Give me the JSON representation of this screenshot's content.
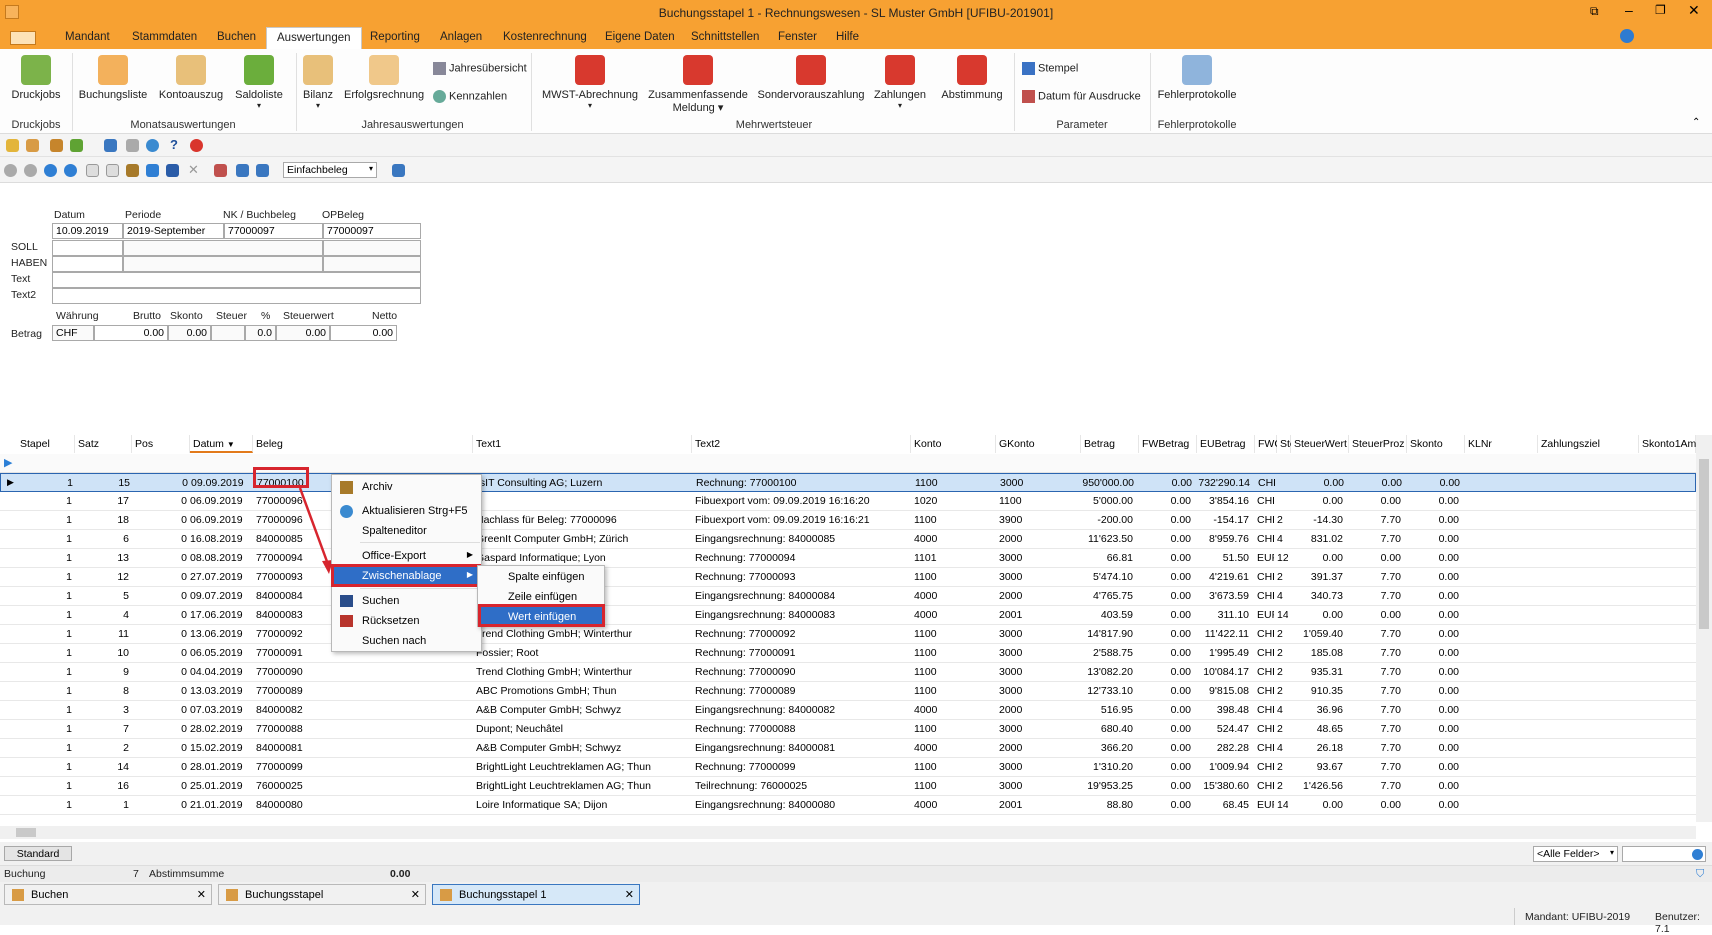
{
  "window": {
    "title": "Buchungsstapel 1 - Rechnungswesen - SL Muster GmbH [UFIBU-201901]"
  },
  "menu": [
    "Mandant",
    "Stammdaten",
    "Buchen",
    "Auswertungen",
    "Reporting",
    "Anlagen",
    "Kostenrechnung",
    "Eigene Daten",
    "Schnittstellen",
    "Fenster",
    "Hilfe"
  ],
  "ribbon": {
    "druckjobs": "Druckjobs",
    "buchungsliste": "Buchungsliste",
    "kontoauszug": "Kontoauszug",
    "saldoliste": "Saldoliste",
    "bilanz": "Bilanz",
    "erfolgsrechnung": "Erfolgsrechnung",
    "jahresuebersicht": "Jahresübersicht",
    "kennzahlen": "Kennzahlen",
    "mwst": "MWST-Abrechnung",
    "zusammen1": "Zusammenfassende",
    "zusammen2": "Meldung",
    "sonder": "Sondervorauszahlung",
    "zahlungen": "Zahlungen",
    "abstimmung": "Abstimmung",
    "stempel": "Stempel",
    "datum_druck": "Datum für Ausdrucke",
    "fehlerprotokolle": "Fehlerprotokolle",
    "groups": {
      "druckjobs": "Druckjobs",
      "monat": "Monatsauswertungen",
      "jahr": "Jahresauswertungen",
      "mwst": "Mehrwertsteuer",
      "parameter": "Parameter",
      "fehler": "Fehlerprotokolle"
    }
  },
  "toolbar": {
    "beleg_type": "Einfachbeleg"
  },
  "form": {
    "labels": {
      "datum": "Datum",
      "periode": "Periode",
      "nk": "NK / Buchbeleg",
      "opbeleg": "OPBeleg",
      "soll": "SOLL",
      "haben": "HABEN",
      "text": "Text",
      "text2": "Text2",
      "waehrung": "Währung",
      "brutto": "Brutto",
      "skonto": "Skonto",
      "steuer": "Steuer",
      "pct": "%",
      "steuerwert": "Steuerwert",
      "netto": "Netto",
      "betrag": "Betrag"
    },
    "values": {
      "datum": "10.09.2019",
      "periode": "2019-September",
      "nk": "77000097",
      "opbeleg": "77000097",
      "waehrung": "CHF",
      "brutto": "0.00",
      "skonto": "0.00",
      "pct": "0.0",
      "steuerwert": "0.00",
      "netto": "0.00"
    }
  },
  "grid": {
    "headers": [
      "Stapel",
      "Satz",
      "Pos",
      "Datum",
      "Beleg",
      "Text1",
      "Text2",
      "Konto",
      "GKonto",
      "Betrag",
      "FWBetrag",
      "EUBetrag",
      "FWC",
      "Ste",
      "SteuerWert",
      "SteuerProz",
      "Skonto",
      "KLNr",
      "Zahlungsziel",
      "Skonto1Am"
    ],
    "rows": [
      [
        "1",
        "15",
        "0",
        "09.09.2019",
        "77000100",
        "IsIT Consulting AG; Luzern",
        "Rechnung: 77000100",
        "1100",
        "3000",
        "950'000.00",
        "0.00",
        "732'290.14",
        "CHF",
        "",
        "0.00",
        "0.00",
        "0.00"
      ],
      [
        "1",
        "17",
        "0",
        "06.09.2019",
        "77000096",
        "",
        "Fibuexport vom: 09.09.2019 16:16:20",
        "1020",
        "1100",
        "5'000.00",
        "0.00",
        "3'854.16",
        "CHF",
        "",
        "0.00",
        "0.00",
        "0.00"
      ],
      [
        "1",
        "18",
        "0",
        "06.09.2019",
        "77000096",
        "Nachlass für Beleg: 77000096",
        "Fibuexport vom: 09.09.2019 16:16:21",
        "1100",
        "3900",
        "-200.00",
        "0.00",
        "-154.17",
        "CHF",
        "2",
        "-14.30",
        "7.70",
        "0.00"
      ],
      [
        "1",
        "6",
        "0",
        "16.08.2019",
        "84000085",
        "GreenIt Computer GmbH; Zürich",
        "Eingangsrechnung: 84000085",
        "4000",
        "2000",
        "11'623.50",
        "0.00",
        "8'959.76",
        "CHF",
        "4",
        "831.02",
        "7.70",
        "0.00"
      ],
      [
        "1",
        "13",
        "0",
        "08.08.2019",
        "77000094",
        "Gaspard Informatique; Lyon",
        "Rechnung: 77000094",
        "1101",
        "3000",
        "66.81",
        "0.00",
        "51.50",
        "EUF",
        "12",
        "0.00",
        "0.00",
        "0.00"
      ],
      [
        "1",
        "12",
        "0",
        "27.07.2019",
        "77000093",
        "",
        "Rechnung: 77000093",
        "1100",
        "3000",
        "5'474.10",
        "0.00",
        "4'219.61",
        "CHF",
        "2",
        "391.37",
        "7.70",
        "0.00"
      ],
      [
        "1",
        "5",
        "0",
        "09.07.2019",
        "84000084",
        "",
        "Eingangsrechnung: 84000084",
        "4000",
        "2000",
        "4'765.75",
        "0.00",
        "3'673.59",
        "CHF",
        "4",
        "340.73",
        "7.70",
        "0.00"
      ],
      [
        "1",
        "4",
        "0",
        "17.06.2019",
        "84000083",
        "",
        "Eingangsrechnung: 84000083",
        "4000",
        "2001",
        "403.59",
        "0.00",
        "311.10",
        "EUF",
        "14",
        "0.00",
        "0.00",
        "0.00"
      ],
      [
        "1",
        "11",
        "0",
        "13.06.2019",
        "77000092",
        "Trend Clothing GmbH; Winterthur",
        "Rechnung: 77000092",
        "1100",
        "3000",
        "14'817.90",
        "0.00",
        "11'422.11",
        "CHF",
        "2",
        "1'059.40",
        "7.70",
        "0.00"
      ],
      [
        "1",
        "10",
        "0",
        "06.05.2019",
        "77000091",
        "Fossier; Root",
        "Rechnung: 77000091",
        "1100",
        "3000",
        "2'588.75",
        "0.00",
        "1'995.49",
        "CHF",
        "2",
        "185.08",
        "7.70",
        "0.00"
      ],
      [
        "1",
        "9",
        "0",
        "04.04.2019",
        "77000090",
        "Trend Clothing GmbH; Winterthur",
        "Rechnung: 77000090",
        "1100",
        "3000",
        "13'082.20",
        "0.00",
        "10'084.17",
        "CHF",
        "2",
        "935.31",
        "7.70",
        "0.00"
      ],
      [
        "1",
        "8",
        "0",
        "13.03.2019",
        "77000089",
        "ABC Promotions GmbH; Thun",
        "Rechnung: 77000089",
        "1100",
        "3000",
        "12'733.10",
        "0.00",
        "9'815.08",
        "CHF",
        "2",
        "910.35",
        "7.70",
        "0.00"
      ],
      [
        "1",
        "3",
        "0",
        "07.03.2019",
        "84000082",
        "A&B Computer GmbH; Schwyz",
        "Eingangsrechnung: 84000082",
        "4000",
        "2000",
        "516.95",
        "0.00",
        "398.48",
        "CHF",
        "4",
        "36.96",
        "7.70",
        "0.00"
      ],
      [
        "1",
        "7",
        "0",
        "28.02.2019",
        "77000088",
        "Dupont; Neuchâtel",
        "Rechnung: 77000088",
        "1100",
        "3000",
        "680.40",
        "0.00",
        "524.47",
        "CHF",
        "2",
        "48.65",
        "7.70",
        "0.00"
      ],
      [
        "1",
        "2",
        "0",
        "15.02.2019",
        "84000081",
        "A&B Computer GmbH; Schwyz",
        "Eingangsrechnung: 84000081",
        "4000",
        "2000",
        "366.20",
        "0.00",
        "282.28",
        "CHF",
        "4",
        "26.18",
        "7.70",
        "0.00"
      ],
      [
        "1",
        "14",
        "0",
        "28.01.2019",
        "77000099",
        "BrightLight Leuchtreklamen AG; Thun",
        "Rechnung: 77000099",
        "1100",
        "3000",
        "1'310.20",
        "0.00",
        "1'009.94",
        "CHF",
        "2",
        "93.67",
        "7.70",
        "0.00"
      ],
      [
        "1",
        "16",
        "0",
        "25.01.2019",
        "76000025",
        "BrightLight Leuchtreklamen AG; Thun",
        "Teilrechnung: 76000025",
        "1100",
        "3000",
        "19'953.25",
        "0.00",
        "15'380.60",
        "CHF",
        "2",
        "1'426.56",
        "7.70",
        "0.00"
      ],
      [
        "1",
        "1",
        "0",
        "21.01.2019",
        "84000080",
        "Loire Informatique SA; Dijon",
        "Eingangsrechnung: 84000080",
        "4000",
        "2001",
        "88.80",
        "0.00",
        "68.45",
        "EUF",
        "14",
        "0.00",
        "0.00",
        "0.00"
      ]
    ]
  },
  "context_menu": {
    "archiv": "Archiv",
    "aktualisieren": "Aktualisieren Strg+F5",
    "spalteneditor": "Spalteneditor",
    "office_export": "Office-Export",
    "zwischenablage": "Zwischenablage",
    "suchen": "Suchen",
    "ruecksetzen": "Rücksetzen",
    "suchen_nach": "Suchen nach"
  },
  "submenu": {
    "spalte": "Spalte einfügen",
    "zeile": "Zeile einfügen",
    "wert": "Wert einfügen"
  },
  "bottom": {
    "standard": "Standard",
    "alle_felder": "<Alle Felder>",
    "buchung": "Buchung",
    "count": "7",
    "abstimmsumme": "Abstimmsumme",
    "abstimm_value": "0.00"
  },
  "tabs": [
    "Buchen",
    "Buchungsstapel",
    "Buchungsstapel 1"
  ],
  "status": {
    "mandant": "Mandant: UFIBU-2019",
    "benutzer": "Benutzer: 7.1"
  }
}
